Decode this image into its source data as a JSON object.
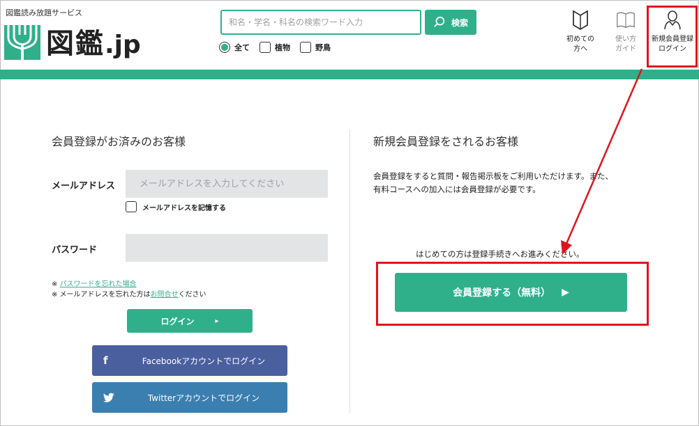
{
  "header": {
    "tagline": "図鑑読み放題サービス",
    "logo_text_main": "図鑑",
    "logo_text_domain": ".jp",
    "search": {
      "placeholder": "和名・学名・科名の検索ワード入力",
      "button_label": "検索"
    },
    "filters": [
      {
        "label": "全て",
        "selected": true
      },
      {
        "label": "植物",
        "selected": false
      },
      {
        "label": "野鳥",
        "selected": false
      }
    ],
    "nav": [
      {
        "line1": "初めての",
        "line2": "方へ",
        "icon": "bookmark-icon"
      },
      {
        "line1": "使い方",
        "line2": "ガイド",
        "icon": "book-icon"
      },
      {
        "line1": "新規会員登録",
        "line2": "ログイン",
        "icon": "user-icon"
      }
    ],
    "accent_color": "#2fb08b"
  },
  "login": {
    "title": "会員登録がお済みのお客様",
    "email_label": "メールアドレス",
    "email_placeholder": "メールアドレスを入力してください",
    "remember_label": "メールアドレスを記憶する",
    "password_label": "パスワード",
    "note1_prefix": "※ ",
    "note1_link": "パスワードを忘れた場合",
    "note2_prefix": "※ メールアドレスを忘れた方は",
    "note2_link": "お問合せ",
    "note2_suffix": "ください",
    "login_button": "ログイン",
    "facebook_button": "Facebookアカウントでログイン",
    "twitter_button": "Twitterアカウントでログイン"
  },
  "register": {
    "title": "新規会員登録をされるお客様",
    "description_line1": "会員登録をすると質問・報告掲示板をご利用いただけます。また、",
    "description_line2": "有料コースへの加入には会員登録が必要です。",
    "first_note": "はじめての方は登録手続きへお進みください。",
    "register_button": "会員登録する（無料）"
  },
  "annotation": {
    "color": "#e0141c"
  }
}
